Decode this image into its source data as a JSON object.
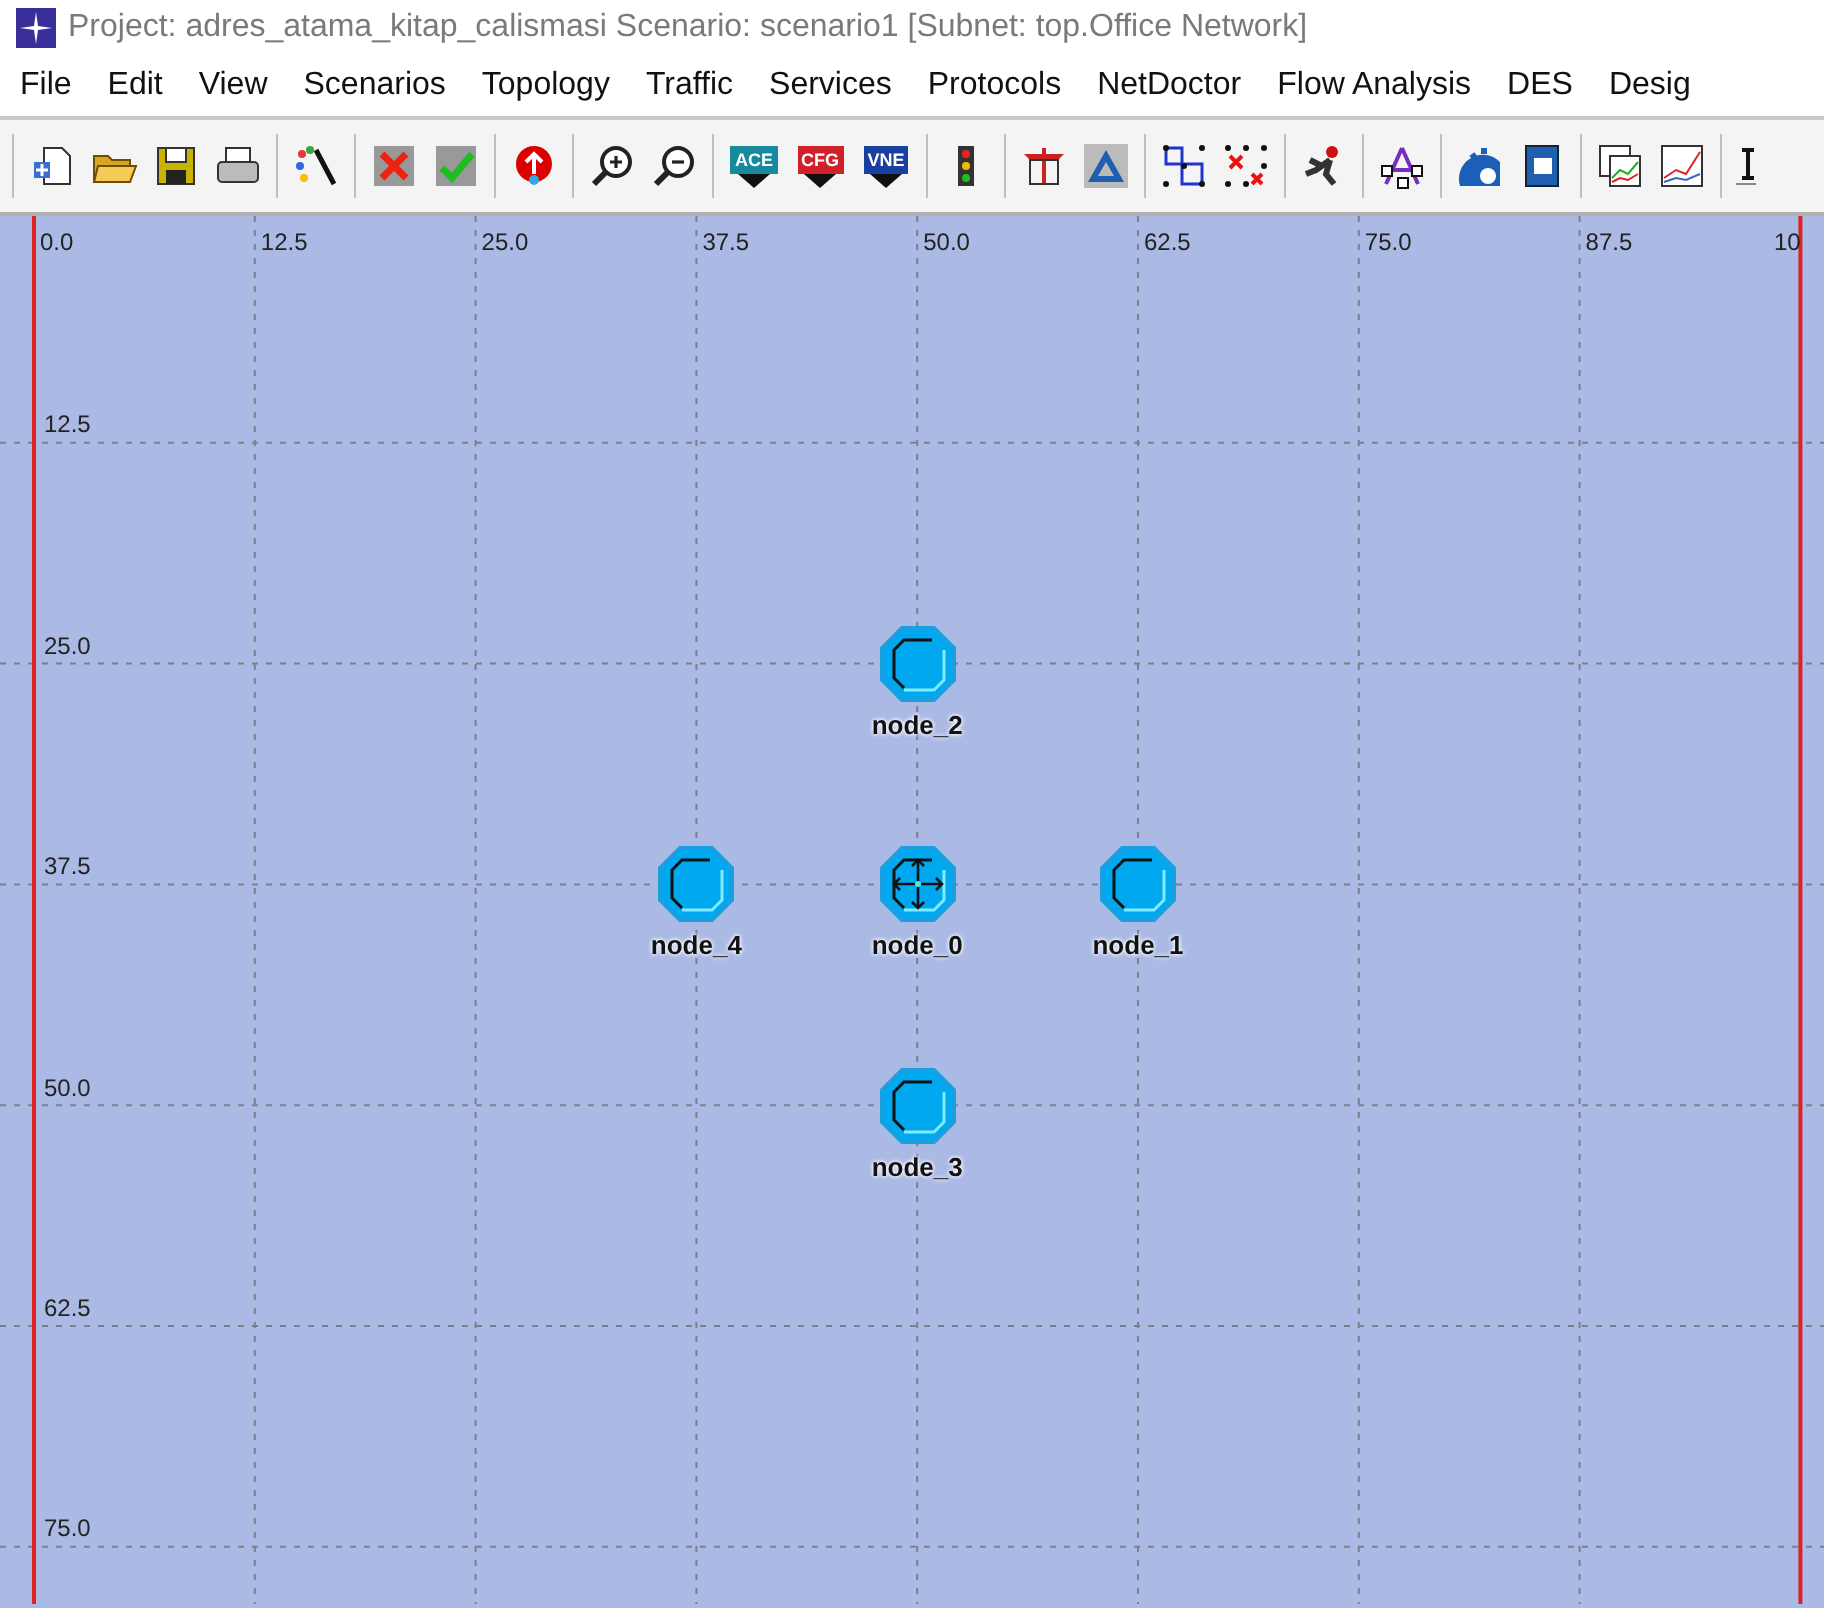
{
  "window": {
    "title": "Project: adres_atama_kitap_calismasi Scenario: scenario1  [Subnet: top.Office Network]"
  },
  "menu": [
    "File",
    "Edit",
    "View",
    "Scenarios",
    "Topology",
    "Traffic",
    "Services",
    "Protocols",
    "NetDoctor",
    "Flow Analysis",
    "DES",
    "Desig"
  ],
  "toolbar": {
    "badges": [
      {
        "label": "ACE",
        "color": "#168a9c"
      },
      {
        "label": "CFG",
        "color": "#d0202a"
      },
      {
        "label": "VNE",
        "color": "#1a3fa0"
      }
    ]
  },
  "canvas": {
    "x_ruler": [
      "0.0",
      "12.5",
      "25.0",
      "37.5",
      "50.0",
      "62.5",
      "75.0",
      "87.5",
      "10"
    ],
    "y_ruler": [
      "12.5",
      "25.0",
      "37.5",
      "50.0",
      "62.5",
      "75.0"
    ],
    "nodes": [
      {
        "name": "node_2",
        "kind": "station"
      },
      {
        "name": "node_4",
        "kind": "station"
      },
      {
        "name": "node_0",
        "kind": "hub"
      },
      {
        "name": "node_1",
        "kind": "station"
      },
      {
        "name": "node_3",
        "kind": "station"
      }
    ]
  }
}
